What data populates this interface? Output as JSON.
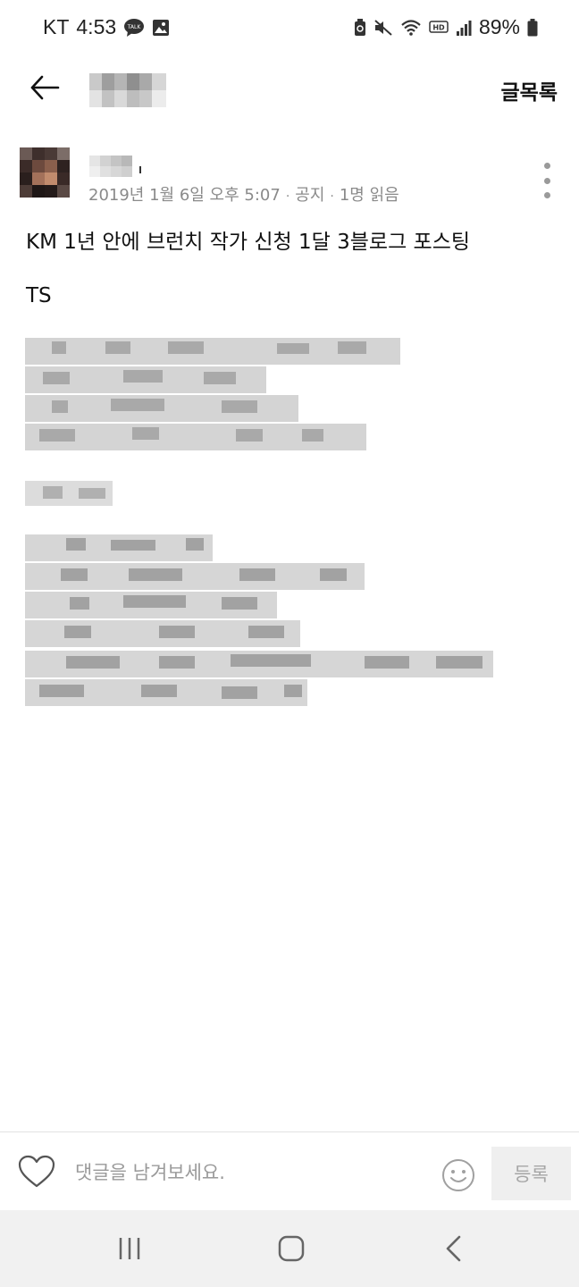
{
  "status_bar": {
    "carrier": "KT",
    "time": "4:53",
    "battery": "89%",
    "left_icons": [
      "kakaotalk-icon",
      "image-icon"
    ],
    "right_icons": [
      "battery-saver-icon",
      "mute-icon",
      "wifi-icon",
      "hd-icon",
      "signal-icon",
      "battery-icon"
    ]
  },
  "top_bar": {
    "back_icon": "arrow-left-icon",
    "list_label": "글목록"
  },
  "post": {
    "meta": {
      "date": "2019년 1월 6일 오후 5:07",
      "category": "공지",
      "reads": "1명 읽음",
      "separator": "·"
    },
    "title": "KM 1년 안에 브런치 작가 신청 1달 3블로그 포스팅",
    "tag_line": "TS"
  },
  "comment_bar": {
    "placeholder": "댓글을 남겨보세요.",
    "submit_label": "등록"
  },
  "nav_bar": {
    "buttons": [
      "recent-apps-icon",
      "home-icon",
      "back-icon"
    ]
  },
  "colors": {
    "meta_text": "#8a8a8a",
    "nav_background": "#f1f1f1",
    "submit_background": "#efefef",
    "submit_text": "#a6a6a6"
  }
}
